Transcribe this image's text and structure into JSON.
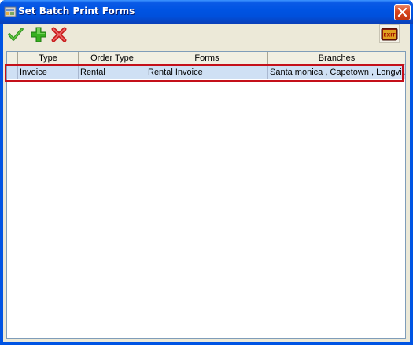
{
  "window": {
    "title": "Set Batch Print Forms",
    "title_bar_color": "#0054e3",
    "body_color": "#ece9d8"
  },
  "toolbar": {
    "confirm_icon": "checkmark-icon",
    "add_icon": "plus-icon",
    "delete_icon": "x-icon",
    "exit_label": "EXIT"
  },
  "table": {
    "columns": [
      "Type",
      "Order Type",
      "Forms",
      "Branches"
    ],
    "rows": [
      {
        "type": "Invoice",
        "order_type": "Rental",
        "forms": "Rental Invoice",
        "branches": "Santa monica , Capetown , Longvi..."
      }
    ],
    "selected_row_color": "#cfe0f4",
    "highlight_color": "#c4101a"
  }
}
